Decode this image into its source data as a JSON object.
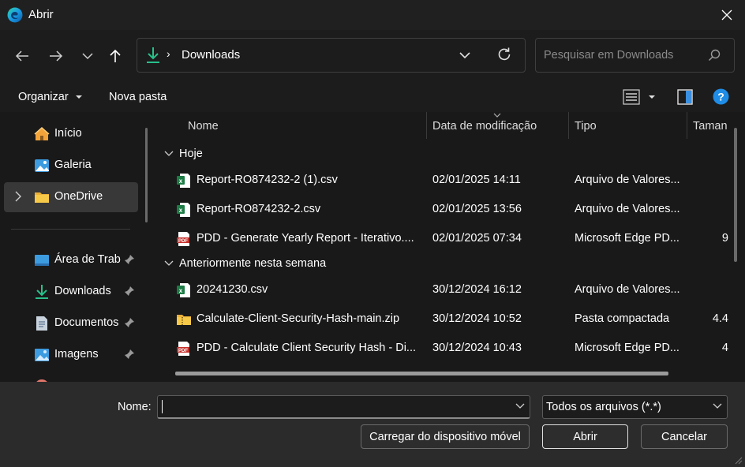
{
  "window": {
    "title": "Abrir"
  },
  "nav": {
    "breadcrumb": [
      "Downloads"
    ],
    "search_placeholder": "Pesquisar em Downloads"
  },
  "toolbar": {
    "organize_label": "Organizar",
    "new_folder_label": "Nova pasta"
  },
  "sidebar": {
    "items": [
      {
        "label": "Início",
        "icon": "home-icon",
        "pinned": false
      },
      {
        "label": "Galeria",
        "icon": "gallery-icon",
        "pinned": false
      },
      {
        "label": "OneDrive",
        "icon": "folder-icon",
        "pinned": false,
        "selected": true
      },
      {
        "label": "Área de Trab",
        "icon": "desktop-icon",
        "pinned": true
      },
      {
        "label": "Downloads",
        "icon": "download-icon",
        "pinned": true
      },
      {
        "label": "Documentos",
        "icon": "documents-icon",
        "pinned": true
      },
      {
        "label": "Imagens",
        "icon": "pictures-icon",
        "pinned": true
      }
    ]
  },
  "filelist": {
    "columns": {
      "name": "Nome",
      "date": "Data de modificação",
      "type": "Tipo",
      "size": "Taman"
    },
    "groups": [
      {
        "label": "Hoje",
        "rows": [
          {
            "name": "Report-RO874232-2 (1).csv",
            "date": "02/01/2025 14:11",
            "type": "Arquivo de Valores Separados por Vírgula",
            "size": "",
            "icon": "excel-csv-icon"
          },
          {
            "name": "Report-RO874232-2.csv",
            "date": "02/01/2025 13:56",
            "type": "Arquivo de Valores Separados por Vírgula",
            "size": "",
            "icon": "excel-csv-icon"
          },
          {
            "name": "PDD - Generate Yearly Report - Iterativo.pdf",
            "date": "02/01/2025 07:34",
            "type": "Microsoft Edge PDF Document",
            "size": "9",
            "icon": "pdf-icon"
          }
        ]
      },
      {
        "label": "Anteriormente nesta semana",
        "rows": [
          {
            "name": "20241230.csv",
            "date": "30/12/2024 16:12",
            "type": "Arquivo de Valores Separados por Vírgula",
            "size": "",
            "icon": "excel-csv-icon"
          },
          {
            "name": "Calculate-Client-Security-Hash-main.zip",
            "date": "30/12/2024 10:52",
            "type": "Pasta compactada",
            "size": "4.4",
            "icon": "zip-folder-icon"
          },
          {
            "name": "PDD - Calculate Client Security Hash - Digital.pdf",
            "date": "30/12/2024 10:43",
            "type": "Microsoft Edge PDF Document",
            "size": "4",
            "icon": "pdf-icon"
          }
        ]
      }
    ]
  },
  "footer": {
    "filename_label": "Nome:",
    "filename_value": "",
    "filetype_value": "Todos os arquivos (*.*)",
    "upload_label": "Carregar do dispositivo móvel",
    "open_label": "Abrir",
    "cancel_label": "Cancelar"
  },
  "colors": {
    "background": "#202020",
    "pane": "#191919",
    "footer": "#2b2b2b",
    "help_accent": "#1f8ce6",
    "download_accent": "#27c08a"
  }
}
